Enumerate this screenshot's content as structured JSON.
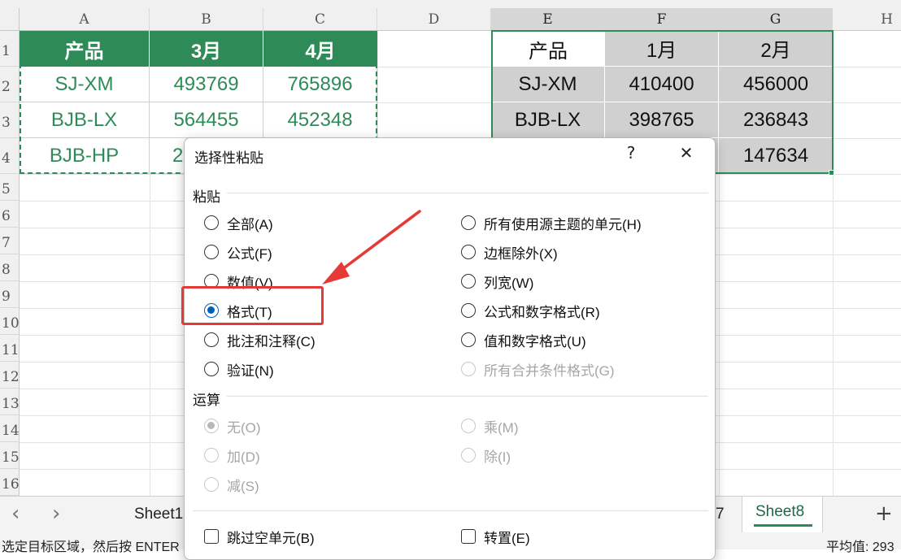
{
  "columns": [
    "A",
    "B",
    "C",
    "D",
    "E",
    "F",
    "G",
    "H"
  ],
  "rows": [
    "1",
    "2",
    "3",
    "4",
    "5",
    "6",
    "7",
    "8",
    "9",
    "10",
    "11",
    "12",
    "13",
    "14",
    "15",
    "16"
  ],
  "left_table": {
    "header": [
      "产品",
      "3月",
      "4月"
    ],
    "rows": [
      [
        "SJ-XM",
        "493769",
        "765896"
      ],
      [
        "BJB-LX",
        "564455",
        "452348"
      ],
      [
        "BJB-HP",
        "2",
        ""
      ]
    ]
  },
  "right_table": {
    "header": [
      "产品",
      "1月",
      "2月"
    ],
    "rows": [
      [
        "SJ-XM",
        "410400",
        "456000"
      ],
      [
        "BJB-LX",
        "398765",
        "236843"
      ],
      [
        "",
        "",
        "147634"
      ]
    ]
  },
  "dialog": {
    "title": "选择性粘贴",
    "help": "?",
    "close": "✕",
    "paste_section": "粘贴",
    "paste_left": [
      {
        "label": "全部(A)",
        "selected": false,
        "disabled": false
      },
      {
        "label": "公式(F)",
        "selected": false,
        "disabled": false
      },
      {
        "label": "数值(V)",
        "selected": false,
        "disabled": false
      },
      {
        "label": "格式(T)",
        "selected": true,
        "disabled": false
      },
      {
        "label": "批注和注释(C)",
        "selected": false,
        "disabled": false
      },
      {
        "label": "验证(N)",
        "selected": false,
        "disabled": false
      }
    ],
    "paste_right": [
      {
        "label": "所有使用源主题的单元(H)",
        "selected": false,
        "disabled": false
      },
      {
        "label": "边框除外(X)",
        "selected": false,
        "disabled": false
      },
      {
        "label": "列宽(W)",
        "selected": false,
        "disabled": false
      },
      {
        "label": "公式和数字格式(R)",
        "selected": false,
        "disabled": false
      },
      {
        "label": "值和数字格式(U)",
        "selected": false,
        "disabled": false
      },
      {
        "label": "所有合并条件格式(G)",
        "selected": false,
        "disabled": true
      }
    ],
    "operation_section": "运算",
    "op_left": [
      {
        "label": "无(O)",
        "selected": true,
        "disabled": true
      },
      {
        "label": "加(D)",
        "selected": false,
        "disabled": true
      },
      {
        "label": "减(S)",
        "selected": false,
        "disabled": true
      }
    ],
    "op_right": [
      {
        "label": "乘(M)",
        "selected": false,
        "disabled": true
      },
      {
        "label": "除(I)",
        "selected": false,
        "disabled": true
      }
    ],
    "skip_blanks": "跳过空单元(B)",
    "transpose": "转置(E)"
  },
  "tabs": {
    "prev": "‹",
    "next": "›",
    "sheet_partial": "Sheet1",
    "sheet_partial_right": "7",
    "active": "Sheet8",
    "add": "+"
  },
  "status": {
    "message": "选定目标区域，然后按 ENTER",
    "average": "平均值: 293"
  },
  "colors": {
    "accent_green": "#2e8b57",
    "radio_blue": "#0060b8",
    "highlight_red": "#e53935"
  }
}
